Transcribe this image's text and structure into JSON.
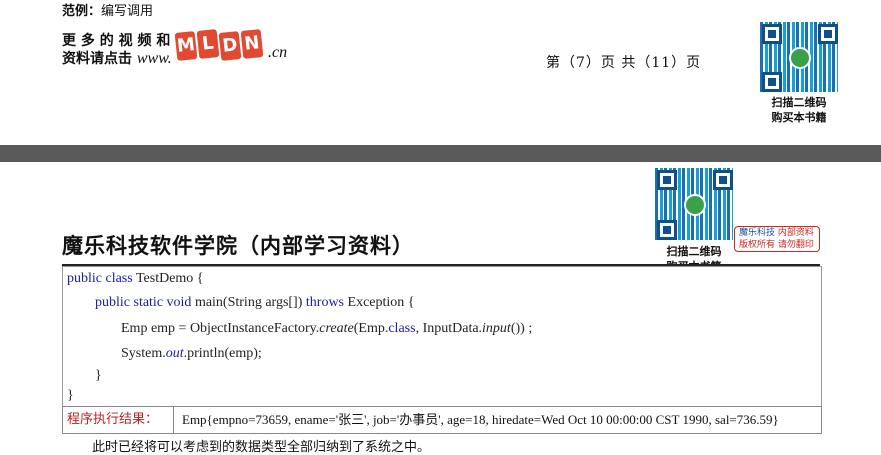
{
  "header": {
    "example_label": "范例：",
    "example_text": "编写调用",
    "promo_line1": "更 多 的 视 频 和",
    "promo_line2_cn": "资料请点击",
    "promo_line2_url": "www.",
    "logo_letters": [
      "M",
      "L",
      "D",
      "N"
    ],
    "logo_suffix": ".cn",
    "page_number": "第（7）页  共（11）页"
  },
  "qr_top": {
    "caption_line1": "扫描二维码",
    "caption_line2": "购买本书籍"
  },
  "qr_mid": {
    "caption_line1": "扫描二维码",
    "caption_line2": "购买本书籍"
  },
  "stamp": {
    "line1_a": "魔乐科技",
    "line1_b": "内部资料",
    "line2": "版权所有 请勿翻印"
  },
  "section_title": "魔乐科技软件学院（内部学习资料）",
  "code": {
    "line1": {
      "kw": "public class",
      "rest": " TestDemo {"
    },
    "line2": {
      "kw1": "public static void",
      "mid": " main(String args[]) ",
      "kw2": "throws",
      "rest": " Exception {"
    },
    "line3": {
      "a": "Emp emp = ObjectInstanceFactory.",
      "b": "create",
      "c": "(Emp.",
      "d": "class",
      "e": ", InputData.",
      "f": "input",
      "g": "()) ;"
    },
    "line4": {
      "a": "System.",
      "b": "out",
      "c": ".println(emp);"
    },
    "line5": "}",
    "line6": "}"
  },
  "result": {
    "label": "程序执行结果：",
    "text": "Emp{empno=73659, ename='张三', job='办事员', age=18, hiredate=Wed Oct 10 00:00:00 CST 1990, sal=736.59}"
  },
  "footer_text": "此时已经将可以考虑到的数据类型全部归纳到了系统之中。"
}
